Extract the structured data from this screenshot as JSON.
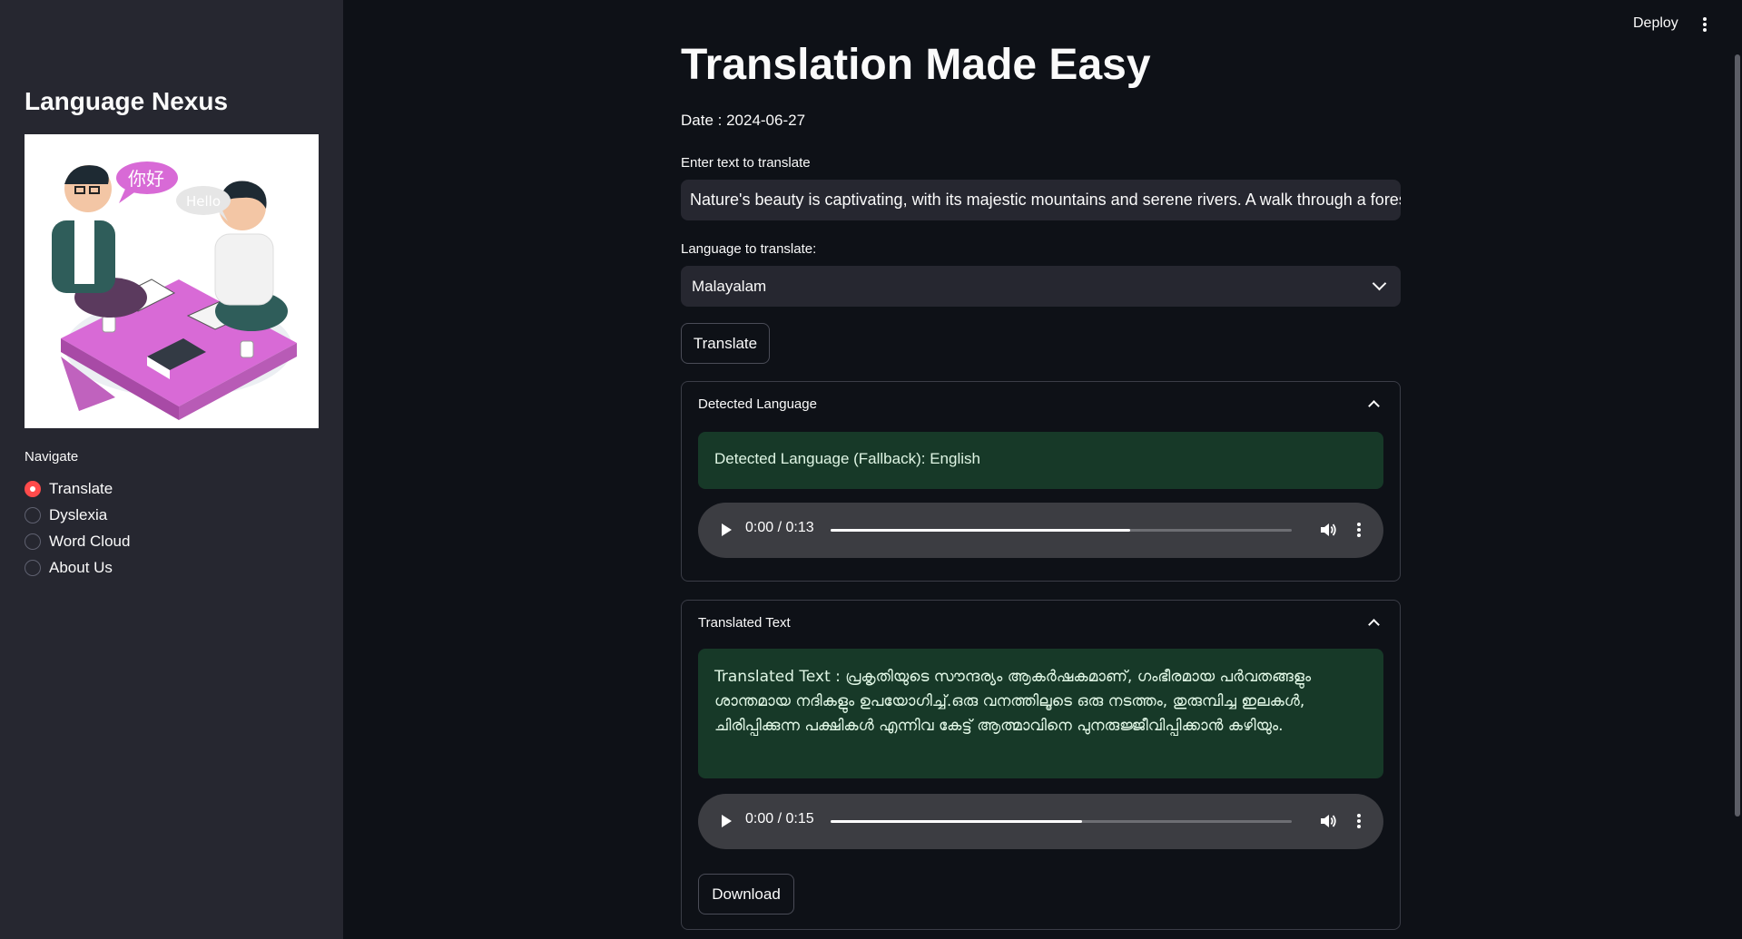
{
  "sidebar": {
    "title": "Language Nexus",
    "image_text": {
      "bubble_left": "你好",
      "bubble_right": "Hello"
    },
    "nav_label": "Navigate",
    "nav_items": [
      {
        "label": "Translate",
        "selected": true
      },
      {
        "label": "Dyslexia",
        "selected": false
      },
      {
        "label": "Word Cloud",
        "selected": false
      },
      {
        "label": "About Us",
        "selected": false
      }
    ]
  },
  "header": {
    "deploy_label": "Deploy",
    "menu_icon": "kebab-menu-icon"
  },
  "main": {
    "title": "Translation Made Easy",
    "date_line": "Date : 2024-06-27",
    "text_input": {
      "label": "Enter text to translate",
      "value": "Nature's beauty is captivating, with its majestic mountains and serene rivers. A walk through a forest, hearing the rustling leaves and chirping birds, can rejuvenate the soul."
    },
    "language_select": {
      "label": "Language to translate:",
      "value": "Malayalam"
    },
    "translate_button": "Translate",
    "detected_expander": {
      "header": "Detected Language",
      "message": "Detected Language (Fallback): English",
      "audio": {
        "time": "0:00 / 0:13",
        "progress": 0.65
      }
    },
    "translated_expander": {
      "header": "Translated Text",
      "message": "Translated Text : പ്രകൃതിയുടെ സൗന്ദര്യം ആകർഷകമാണ്, ഗംഭീരമായ പർവതങ്ങളും ശാന്തമായ നദികളും ഉപയോഗിച്ച്.ഒരു വനത്തിലൂടെ ഒരു നടത്തം, തുരുമ്പിച്ച ഇലകൾ, ചിരിപ്പിക്കുന്ന പക്ഷികൾ എന്നിവ കേട്ട് ആത്മാവിനെ പുനരുജ്ജീവിപ്പിക്കാൻ കഴിയും.",
      "audio": {
        "time": "0:00 / 0:15",
        "progress": 0.545
      },
      "download_button": "Download"
    }
  },
  "colors": {
    "background": "#0e1117",
    "sidebar": "#262730",
    "accent": "#ff4b4b",
    "success_bg": "#173928"
  }
}
